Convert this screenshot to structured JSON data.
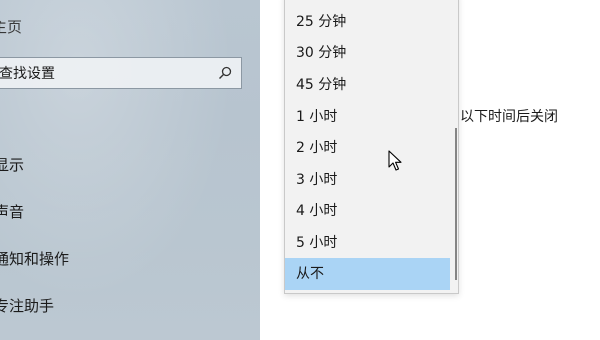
{
  "sidebar": {
    "home_label": "主页",
    "search_placeholder": "查找设置",
    "items": [
      {
        "label": "显示"
      },
      {
        "label": "声音"
      },
      {
        "label": "通知和操作"
      },
      {
        "label": "专注助手"
      }
    ]
  },
  "dropdown": {
    "options": [
      {
        "label": "25 分钟"
      },
      {
        "label": "30 分钟"
      },
      {
        "label": "45 分钟"
      },
      {
        "label": "1 小时"
      },
      {
        "label": "2 小时"
      },
      {
        "label": "3 小时"
      },
      {
        "label": "4 小时"
      },
      {
        "label": "5 小时"
      },
      {
        "label": "从不"
      }
    ],
    "selected": "从不"
  },
  "right_label": "以下时间后关闭",
  "colors": {
    "selection": "#aad4f5",
    "dropdown_bg": "#f2f2f2",
    "sidebar_bg": "#b9c6d1"
  },
  "icons": {
    "search": "search-icon",
    "cursor": "mouse-pointer-icon"
  }
}
